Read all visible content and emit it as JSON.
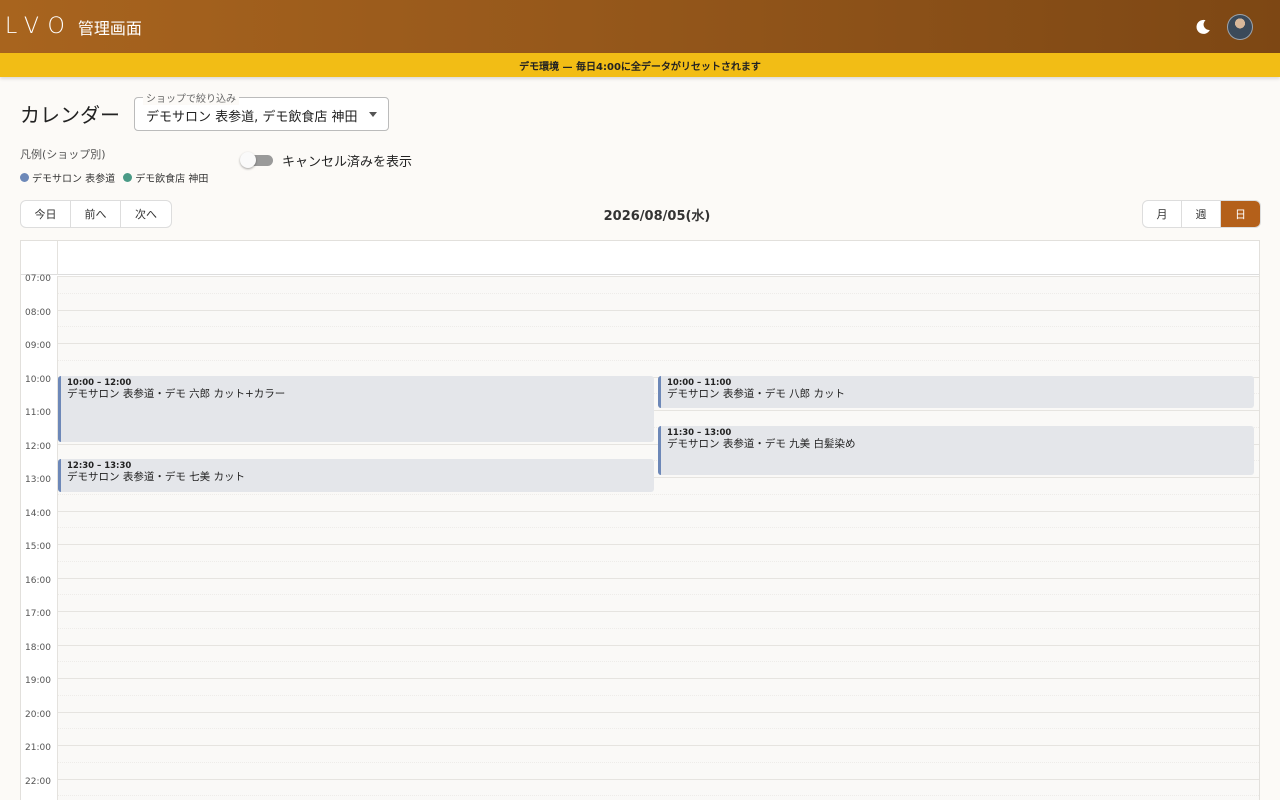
{
  "header": {
    "logo": "LVO",
    "title": "管理画面"
  },
  "banner": {
    "text": "デモ環境 — 毎日4:00に全データがリセットされます"
  },
  "page": {
    "title": "カレンダー"
  },
  "filter": {
    "label": "ショップで絞り込み",
    "value": "デモサロン 表参道, デモ飲食店 神田"
  },
  "legend": {
    "title": "凡例(ショップ別)",
    "items": [
      {
        "label": "デモサロン 表参道",
        "color": "#6d88b8"
      },
      {
        "label": "デモ飲食店 神田",
        "color": "#4a9a86"
      }
    ]
  },
  "toggle": {
    "label": "キャンセル済みを表示",
    "checked": false
  },
  "nav": {
    "today": "今日",
    "prev": "前へ",
    "next": "次へ"
  },
  "date_title": "2026/08/05(水)",
  "views": {
    "month": "月",
    "week": "週",
    "day": "日",
    "active": "day"
  },
  "time_labels": [
    "07:00",
    "08:00",
    "09:00",
    "10:00",
    "11:00",
    "12:00",
    "13:00",
    "14:00",
    "15:00",
    "16:00",
    "17:00",
    "18:00",
    "19:00",
    "20:00",
    "21:00",
    "22:00"
  ],
  "events": [
    {
      "time": "10:00 – 12:00",
      "title": "デモサロン 表参道・デモ 六郎 カット+カラー",
      "start": "10:00",
      "end": "12:00",
      "column": 0
    },
    {
      "time": "12:30 – 13:30",
      "title": "デモサロン 表参道・デモ 七美 カット",
      "start": "12:30",
      "end": "13:30",
      "column": 0
    },
    {
      "time": "10:00 – 11:00",
      "title": "デモサロン 表参道・デモ 八郎 カット",
      "start": "10:00",
      "end": "11:00",
      "column": 1
    },
    {
      "time": "11:30 – 13:00",
      "title": "デモサロン 表参道・デモ 九美 白髪染め",
      "start": "11:30",
      "end": "13:00",
      "column": 1
    }
  ],
  "colors": {
    "accent": "#b4601a",
    "banner": "#f2bd15",
    "event_border": "#6d88b8",
    "event_bg": "#e4e6ea"
  }
}
